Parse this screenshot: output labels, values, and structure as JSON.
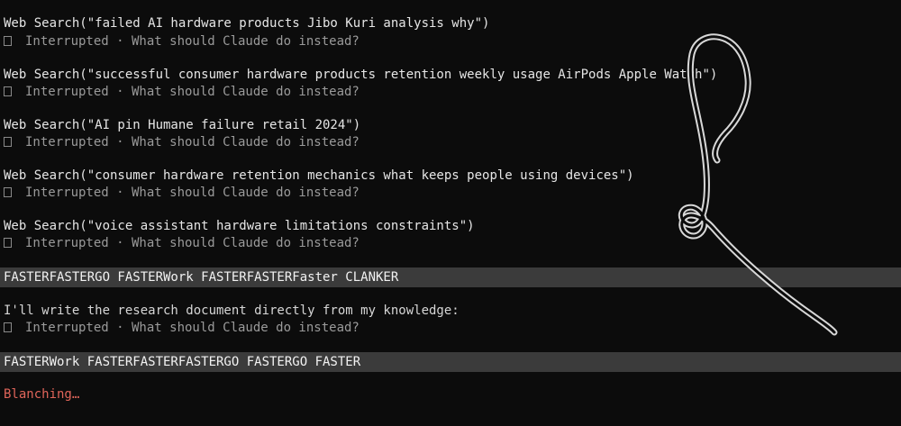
{
  "entries": [
    {
      "call": "Web Search(\"failed AI hardware products Jibo Kuri analysis why\")",
      "interrupt": "Interrupted · What should Claude do instead?"
    },
    {
      "call": "Web Search(\"successful consumer hardware products retention weekly usage AirPods Apple Watch\")",
      "interrupt": "Interrupted · What should Claude do instead?"
    },
    {
      "call": "Web Search(\"AI pin Humane failure retail 2024\")",
      "interrupt": "Interrupted · What should Claude do instead?"
    },
    {
      "call": "Web Search(\"consumer hardware retention mechanics what keeps people using devices\")",
      "interrupt": "Interrupted · What should Claude do instead?"
    },
    {
      "call": "Web Search(\"voice assistant hardware limitations constraints\")",
      "interrupt": "Interrupted · What should Claude do instead?"
    }
  ],
  "user_message_1": "FASTERFASTERGO FASTERWork FASTERFASTERFaster CLANKER",
  "assistant_message": "I'll write the research document directly from my knowledge:",
  "assistant_interrupt": "Interrupted · What should Claude do instead?",
  "user_message_2": "FASTERWork FASTERFASTERFASTERGO FASTERGO FASTER",
  "status_text": "Blanching…",
  "colors": {
    "background": "#0c0c0c",
    "user_message_bar": "#3b3b3b",
    "status": "#e0655a",
    "dim_text": "#9a9a9a"
  },
  "icons": [
    "interrupt-glyph-icon",
    "scribble-drawing"
  ]
}
